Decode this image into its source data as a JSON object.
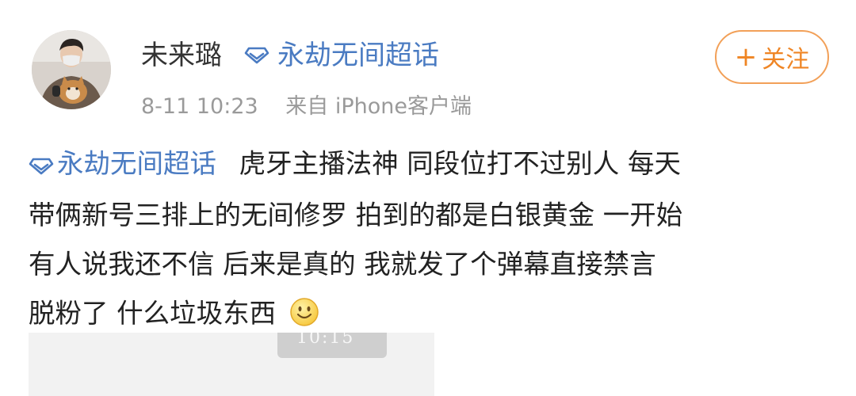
{
  "user": {
    "name": "未来璐",
    "topic": "永劫无间超话"
  },
  "meta": {
    "time": "8-11 10:23",
    "source": "来自 iPhone客户端"
  },
  "follow": {
    "plus": "+",
    "label": "关注"
  },
  "post": {
    "inline_topic": "永劫无间超话",
    "lines": [
      "虎牙主播法神 同段位打不过别人 每天",
      "带俩新号三排上的无间修罗 拍到的都是白银黄金 一开始",
      "有人说我还不信 后来是真的 我就发了个弹幕直接禁言",
      "脱粉了 什么垃圾东西"
    ]
  },
  "image": {
    "badge_text": "10:15"
  },
  "colors": {
    "link": "#4a7bc2",
    "follow_border": "#f2a058",
    "follow_text": "#ef8524",
    "meta": "#9a9a9a"
  },
  "icons": {
    "topic": "diamond-topic-icon",
    "emoji": "smiley-emoji-icon"
  }
}
